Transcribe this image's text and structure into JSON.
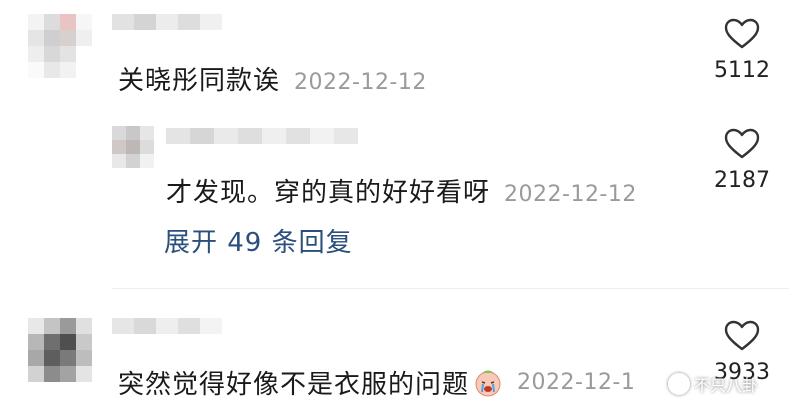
{
  "comments": [
    {
      "text": "关晓彤同款诶",
      "date": "2022-12-12",
      "likes": "5112"
    },
    {
      "text": "才发现。穿的真的好好看呀",
      "date": "2022-12-12",
      "likes": "2187",
      "expand_label": "展开 49 条回复"
    },
    {
      "text": "突然觉得好像不是衣服的问题",
      "date": "2022-12-1",
      "likes": "3933",
      "emoji_icon": "crying-face-icon"
    }
  ],
  "watermark": {
    "text": "不只八卦"
  },
  "colors": {
    "date": "#9a9a9a",
    "expand_link": "#2a4f7c",
    "heart_stroke": "#333333"
  }
}
